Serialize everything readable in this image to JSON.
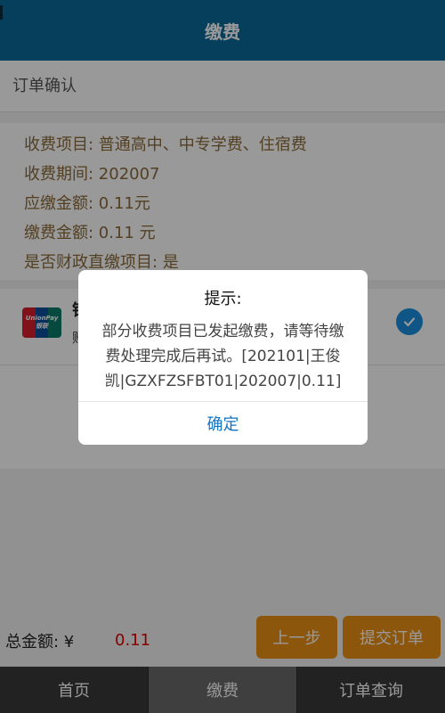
{
  "header": {
    "title": "缴费"
  },
  "section": {
    "title": "订单确认"
  },
  "order": {
    "rows": [
      "收费项目: 普通高中、中专学费、住宿费",
      "收费期间: 202007",
      "应缴金额: 0.11元",
      "缴费金额: 0.11 元",
      "是否财政直缴项目: 是"
    ]
  },
  "payment": {
    "method_name": "银联",
    "method_sub": "账",
    "logo_text": "UnionPay 银联"
  },
  "footer": {
    "total_label": "总金额: ¥",
    "total_value": "0.11",
    "prev_label": "上一步",
    "submit_label": "提交订单"
  },
  "nav": {
    "items": [
      "首页",
      "缴费",
      "订单查询"
    ],
    "active_index": 1
  },
  "dialog": {
    "title": "提示:",
    "message": "部分收费项目已发起缴费，请等待缴费处理完成后再试。[202101|王俊凯|GZXFZSFBT01|202007|0.11]",
    "confirm_label": "确定"
  },
  "colors": {
    "header_bg": "#0a6a9a",
    "accent_orange": "#e98f17",
    "price_red": "#e00000",
    "link_blue": "#1273c2",
    "check_blue": "#1a8fe0"
  }
}
